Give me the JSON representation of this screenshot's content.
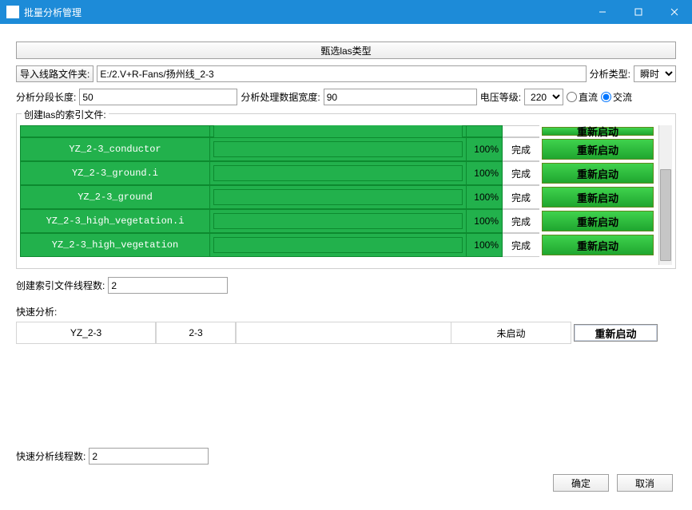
{
  "window": {
    "title": "批量分析管理"
  },
  "filter_las_label": "甄选las类型",
  "import": {
    "button": "导入线路文件夹:",
    "path": "E:/2.V+R-Fans/扬州线_2-3",
    "analysis_type_label": "分析类型:",
    "analysis_type_value": "瞬时"
  },
  "params": {
    "seg_len_label": "分析分段长度:",
    "seg_len_value": "50",
    "data_width_label": "分析处理数据宽度:",
    "data_width_value": "90",
    "voltage_label": "电压等级:",
    "voltage_value": "220",
    "dc_label": "直流",
    "ac_label": "交流",
    "current_type": "ac"
  },
  "index": {
    "group_label": "创建las的索引文件:",
    "restart_label": "重新启动",
    "rows": [
      {
        "name": "YZ_2-3_conductor",
        "pct": "100%",
        "status": "完成"
      },
      {
        "name": "YZ_2-3_ground.i",
        "pct": "100%",
        "status": "完成"
      },
      {
        "name": "YZ_2-3_ground",
        "pct": "100%",
        "status": "完成"
      },
      {
        "name": "YZ_2-3_high_vegetation.i",
        "pct": "100%",
        "status": "完成"
      },
      {
        "name": "YZ_2-3_high_vegetation",
        "pct": "100%",
        "status": "完成"
      }
    ]
  },
  "index_threads": {
    "label": "创建索引文件线程数:",
    "value": "2"
  },
  "fast": {
    "label": "快速分析:",
    "rows": [
      {
        "name": "YZ_2-3",
        "seg": "2-3",
        "status": "未启动",
        "btn": "重新启动"
      }
    ]
  },
  "fast_threads": {
    "label": "快速分析线程数:",
    "value": "2"
  },
  "footer": {
    "ok": "确定",
    "cancel": "取消"
  }
}
